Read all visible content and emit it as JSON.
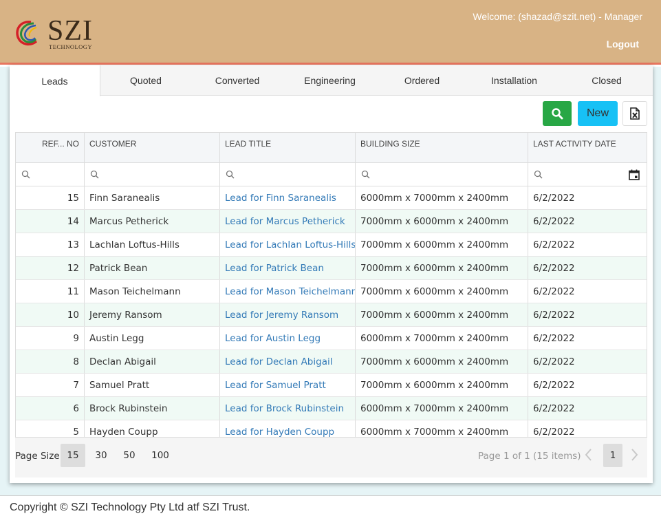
{
  "header": {
    "logo_text": "SZI",
    "logo_subtext": "TECHNOLOGY",
    "welcome": "Welcome: (shazad@szit.net) - Manager",
    "logout": "Logout"
  },
  "tabs": [
    "Leads",
    "Quoted",
    "Converted",
    "Engineering",
    "Ordered",
    "Installation",
    "Closed"
  ],
  "active_tab": "Leads",
  "toolbar": {
    "new_label": "New"
  },
  "grid": {
    "columns": [
      "REF... NO",
      "CUSTOMER",
      "LEAD TITLE",
      "BUILDING SIZE",
      "LAST ACTIVITY DATE"
    ],
    "rows": [
      {
        "ref": "15",
        "customer": "Finn Saranealis",
        "title": "Lead for Finn Saranealis",
        "size": "6000mm x 7000mm x 2400mm",
        "date": "6/2/2022"
      },
      {
        "ref": "14",
        "customer": "Marcus Petherick",
        "title": "Lead for Marcus Petherick",
        "size": "7000mm x 6000mm x 2400mm",
        "date": "6/2/2022"
      },
      {
        "ref": "13",
        "customer": "Lachlan Loftus-Hills",
        "title": "Lead for Lachlan Loftus-Hills",
        "size": "7000mm x 6000mm x 2400mm",
        "date": "6/2/2022"
      },
      {
        "ref": "12",
        "customer": "Patrick Bean",
        "title": "Lead for Patrick Bean",
        "size": "7000mm x 6000mm x 2400mm",
        "date": "6/2/2022"
      },
      {
        "ref": "11",
        "customer": "Mason Teichelmann",
        "title": "Lead for Mason Teichelmann",
        "size": "7000mm x 6000mm x 2400mm",
        "date": "6/2/2022"
      },
      {
        "ref": "10",
        "customer": "Jeremy Ransom",
        "title": "Lead for Jeremy Ransom",
        "size": "7000mm x 6000mm x 2400mm",
        "date": "6/2/2022"
      },
      {
        "ref": "9",
        "customer": "Austin Legg",
        "title": "Lead for Austin Legg",
        "size": "6000mm x 7000mm x 2400mm",
        "date": "6/2/2022"
      },
      {
        "ref": "8",
        "customer": "Declan Abigail",
        "title": "Lead for Declan Abigail",
        "size": "7000mm x 6000mm x 2400mm",
        "date": "6/2/2022"
      },
      {
        "ref": "7",
        "customer": "Samuel Pratt",
        "title": "Lead for Samuel Pratt",
        "size": "7000mm x 6000mm x 2400mm",
        "date": "6/2/2022"
      },
      {
        "ref": "6",
        "customer": "Brock Rubinstein",
        "title": "Lead for Brock Rubinstein",
        "size": "6000mm x 7000mm x 2400mm",
        "date": "6/2/2022"
      },
      {
        "ref": "5",
        "customer": "Hayden Coupp",
        "title": "Lead for Hayden Coupp",
        "size": "6000mm x 7000mm x 2400mm",
        "date": "6/2/2022"
      }
    ]
  },
  "pager": {
    "page_size_label": "Page Size:",
    "page_sizes": [
      "15",
      "30",
      "50",
      "100"
    ],
    "selected_page_size": "15",
    "info": "Page 1 of 1 (15 items)",
    "current_page": "1"
  },
  "footer": {
    "copyright": "Copyright © SZI Technology Pty Ltd atf SZI Trust."
  },
  "colors": {
    "header_bg": "#d8b385",
    "header_border": "#e8765f",
    "search_button": "#28a745",
    "new_button": "#17c1f5",
    "link": "#337ab7",
    "alt_row": "#f0faf5"
  },
  "icons": [
    "search-icon",
    "excel-export-icon",
    "calendar-icon",
    "chevron-left-icon",
    "chevron-right-icon"
  ]
}
